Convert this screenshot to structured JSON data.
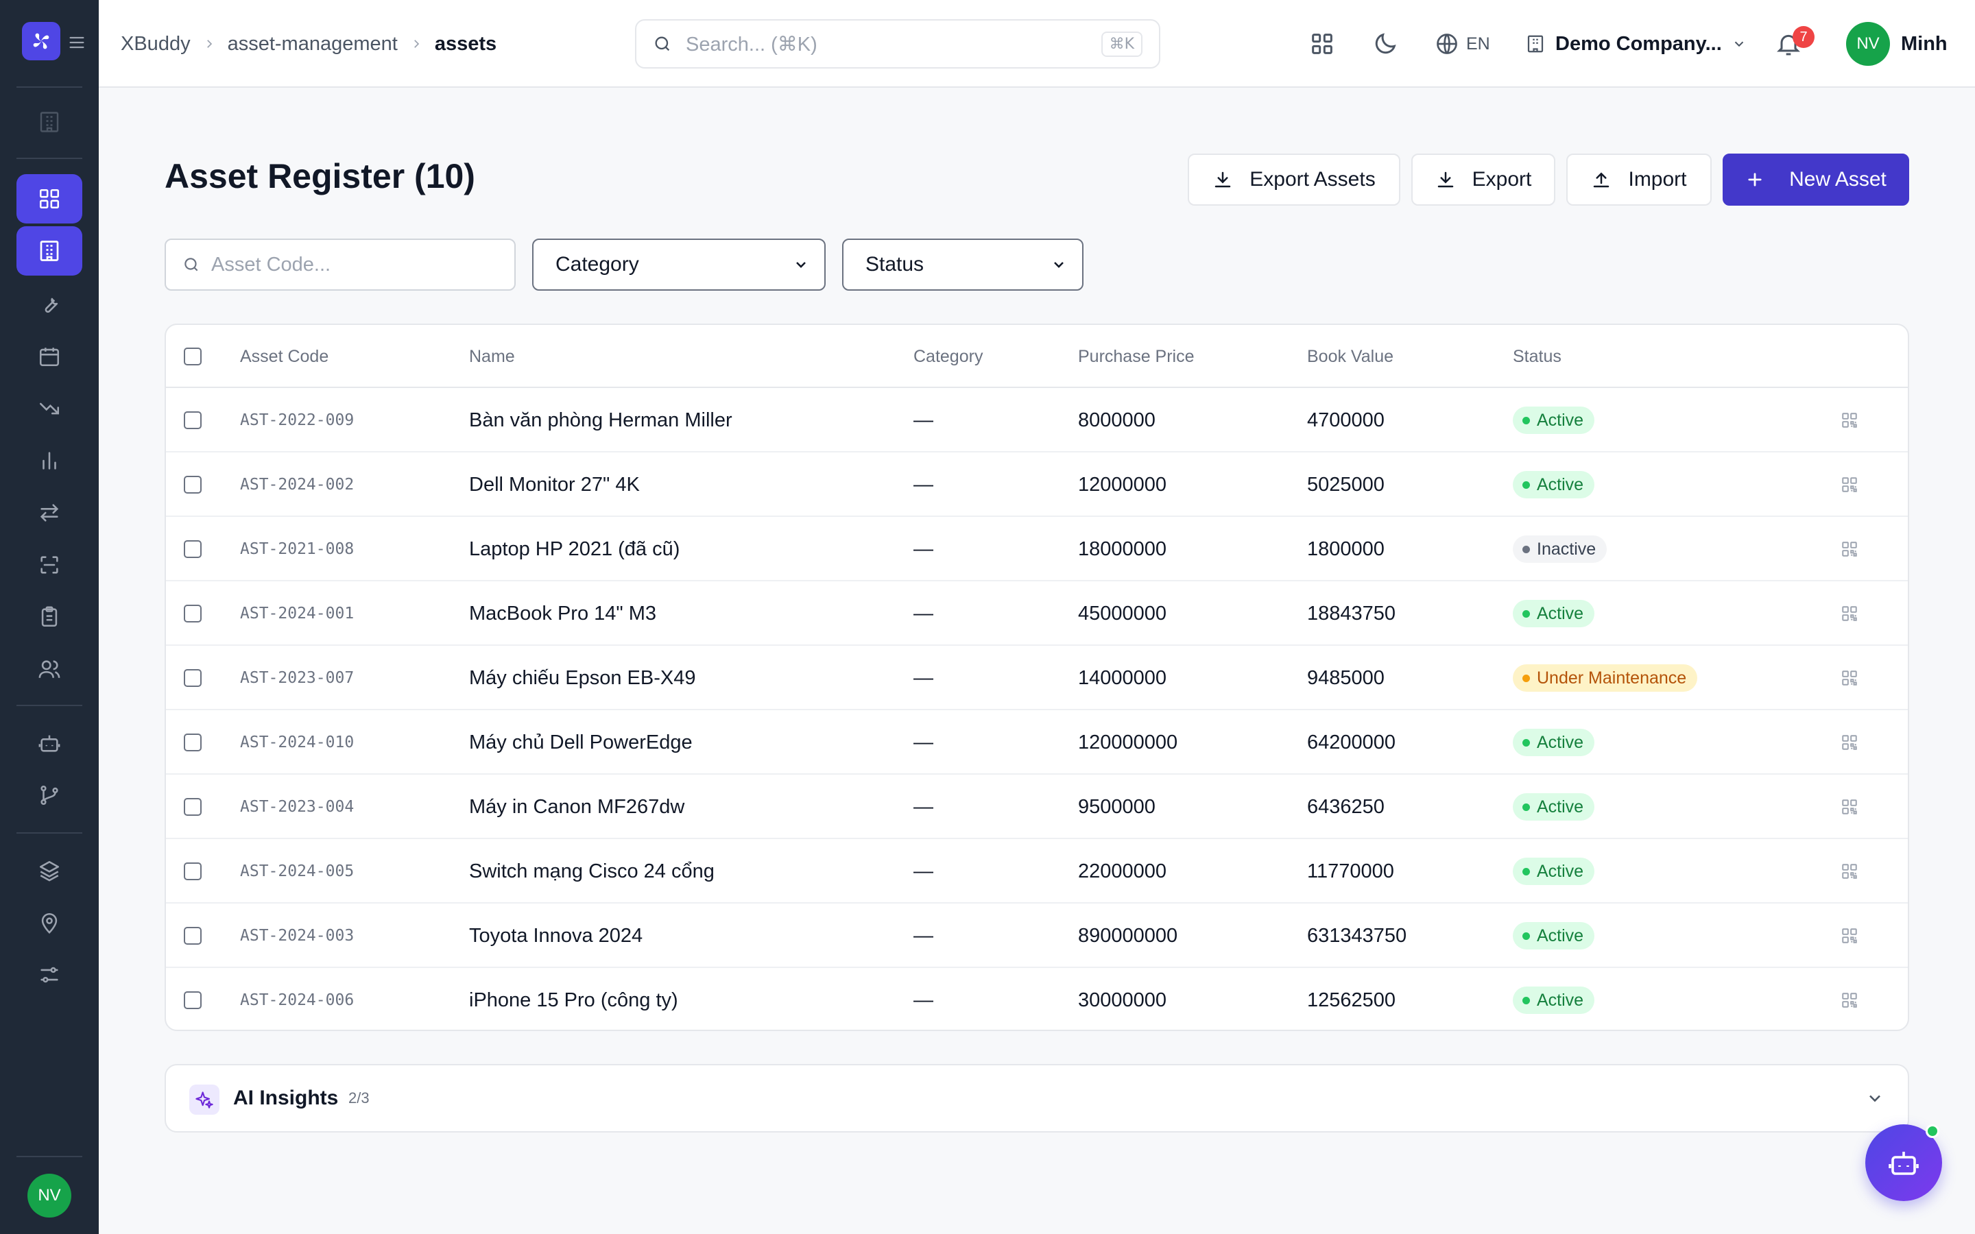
{
  "breadcrumb": [
    "XBuddy",
    "asset-management",
    "assets"
  ],
  "search": {
    "placeholder": "Search... (⌘K)",
    "shortcut": "⌘K"
  },
  "header": {
    "language": "EN",
    "company": "Demo Company...",
    "notifications": "7",
    "user_initials": "NV",
    "user_name": "Minh"
  },
  "sidebar": {
    "user_initials": "NV"
  },
  "page": {
    "title": "Asset Register (10)"
  },
  "actions": {
    "export_assets": "Export Assets",
    "export": "Export",
    "import": "Import",
    "new_asset": "New Asset"
  },
  "filters": {
    "code_placeholder": "Asset Code...",
    "category": "Category",
    "status": "Status"
  },
  "table": {
    "columns": [
      "Asset Code",
      "Name",
      "Category",
      "Purchase Price",
      "Book Value",
      "Status"
    ],
    "rows": [
      {
        "code": "AST-2022-009",
        "name": "Bàn văn phòng Herman Miller",
        "category": "—",
        "purchase_price": "8000000",
        "book_value": "4700000",
        "status": "Active"
      },
      {
        "code": "AST-2024-002",
        "name": "Dell Monitor 27\" 4K",
        "category": "—",
        "purchase_price": "12000000",
        "book_value": "5025000",
        "status": "Active"
      },
      {
        "code": "AST-2021-008",
        "name": "Laptop HP 2021 (đã cũ)",
        "category": "—",
        "purchase_price": "18000000",
        "book_value": "1800000",
        "status": "Inactive"
      },
      {
        "code": "AST-2024-001",
        "name": "MacBook Pro 14\" M3",
        "category": "—",
        "purchase_price": "45000000",
        "book_value": "18843750",
        "status": "Active"
      },
      {
        "code": "AST-2023-007",
        "name": "Máy chiếu Epson EB-X49",
        "category": "—",
        "purchase_price": "14000000",
        "book_value": "9485000",
        "status": "Under Maintenance"
      },
      {
        "code": "AST-2024-010",
        "name": "Máy chủ Dell PowerEdge",
        "category": "—",
        "purchase_price": "120000000",
        "book_value": "64200000",
        "status": "Active"
      },
      {
        "code": "AST-2023-004",
        "name": "Máy in Canon MF267dw",
        "category": "—",
        "purchase_price": "9500000",
        "book_value": "6436250",
        "status": "Active"
      },
      {
        "code": "AST-2024-005",
        "name": "Switch mạng Cisco 24 cổng",
        "category": "—",
        "purchase_price": "22000000",
        "book_value": "11770000",
        "status": "Active"
      },
      {
        "code": "AST-2024-003",
        "name": "Toyota Innova 2024",
        "category": "—",
        "purchase_price": "890000000",
        "book_value": "631343750",
        "status": "Active"
      },
      {
        "code": "AST-2024-006",
        "name": "iPhone 15 Pro (công ty)",
        "category": "—",
        "purchase_price": "30000000",
        "book_value": "12562500",
        "status": "Active"
      }
    ]
  },
  "ai_insights": {
    "title": "AI Insights",
    "count": "2/3"
  },
  "colors": {
    "accent": "#4338ca",
    "sidebar_bg": "#1f2937",
    "active": "#22c55e",
    "maintenance": "#f59e0b",
    "badge": "#ef4444"
  }
}
